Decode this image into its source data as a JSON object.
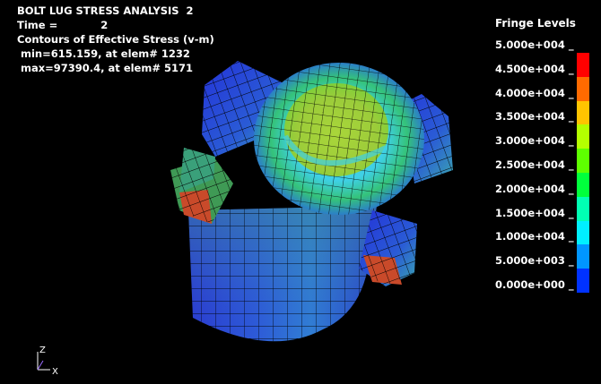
{
  "header": {
    "title": "BOLT LUG STRESS ANALYSIS  2",
    "time_label": "Time =",
    "time_value": "2",
    "contour_label": "Contours of Effective Stress (v-m)",
    "min_text": " min=615.159, at elem# 1232",
    "max_text": " max=97390.4, at elem# 5171"
  },
  "legend": {
    "title": "Fringe Levels",
    "levels": [
      {
        "label": "5.000e+004",
        "color": "#ff0000"
      },
      {
        "label": "4.500e+004",
        "color": "#ff6a00"
      },
      {
        "label": "4.000e+004",
        "color": "#ffc400"
      },
      {
        "label": "3.500e+004",
        "color": "#b4ff00"
      },
      {
        "label": "3.000e+004",
        "color": "#5eff00"
      },
      {
        "label": "2.500e+004",
        "color": "#00ff3c"
      },
      {
        "label": "2.000e+004",
        "color": "#00ffb4"
      },
      {
        "label": "1.500e+004",
        "color": "#00f0ff"
      },
      {
        "label": "1.000e+004",
        "color": "#0096ff"
      },
      {
        "label": "5.000e+003",
        "color": "#0032ff"
      },
      {
        "label": "0.000e+000",
        "color": "#0000ff"
      }
    ]
  },
  "triad": {
    "z": "Z",
    "x": "X"
  }
}
